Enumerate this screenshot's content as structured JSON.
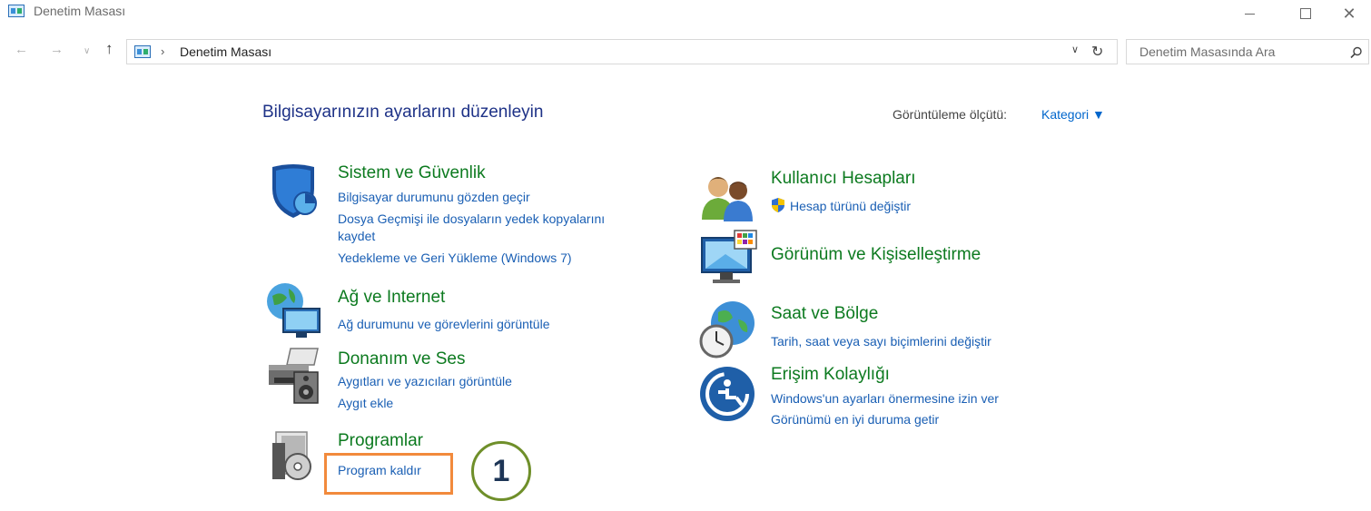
{
  "window": {
    "title": "Denetim Masası",
    "icons": {
      "app": "control-panel-icon",
      "minimize": "minimize-icon",
      "maximize": "maximize-icon",
      "close": "close-icon"
    }
  },
  "nav": {
    "back": "←",
    "forward": "→",
    "recent": "∨",
    "up": "↑",
    "breadcrumb_sep": "›",
    "address": "Denetim Masası",
    "address_dropdown": "∨",
    "refresh": "↻",
    "search_placeholder": "Denetim Masasında Ara"
  },
  "header": {
    "title": "Bilgisayarınızın ayarlarını düzenleyin",
    "view_by_label": "Görüntüleme ölçütü:",
    "view_by_value": "Kategori ▼"
  },
  "categories": {
    "system": {
      "title": "Sistem ve Güvenlik",
      "icon": "shield-icon",
      "links": [
        "Bilgisayar durumunu gözden geçir",
        "Dosya Geçmişi ile dosyaların yedek kopyalarını",
        "kaydet",
        "Yedekleme ve Geri Yükleme (Windows 7)"
      ]
    },
    "network": {
      "title": "Ağ ve Internet",
      "icon": "network-globe-icon",
      "links": [
        "Ağ durumunu ve görevlerini görüntüle"
      ]
    },
    "hardware": {
      "title": "Donanım ve Ses",
      "icon": "printer-speaker-icon",
      "links": [
        "Aygıtları ve yazıcıları görüntüle",
        "Aygıt ekle"
      ]
    },
    "programs": {
      "title": "Programlar",
      "icon": "programs-disc-icon",
      "links": [
        "Program kaldır"
      ]
    },
    "users": {
      "title": "Kullanıcı Hesapları",
      "icon": "users-icon",
      "links": [
        "Hesap türünü değiştir"
      ]
    },
    "appearance": {
      "title": "Görünüm ve Kişiselleştirme",
      "icon": "monitor-palette-icon",
      "links": []
    },
    "clock": {
      "title": "Saat ve Bölge",
      "icon": "clock-globe-icon",
      "links": [
        "Tarih, saat veya sayı biçimlerini değiştir"
      ]
    },
    "access": {
      "title": "Erişim Kolaylığı",
      "icon": "ease-of-access-icon",
      "links": [
        "Windows'un ayarları önermesine izin ver",
        "Görünümü en iyi duruma getir"
      ]
    }
  },
  "annotation": {
    "step": "1"
  },
  "colors": {
    "heading": "#1e3287",
    "category_title": "#0c7a1f",
    "link": "#1a5fb4",
    "highlight": "#f28a3c",
    "step_ring": "#6f8f2a"
  }
}
